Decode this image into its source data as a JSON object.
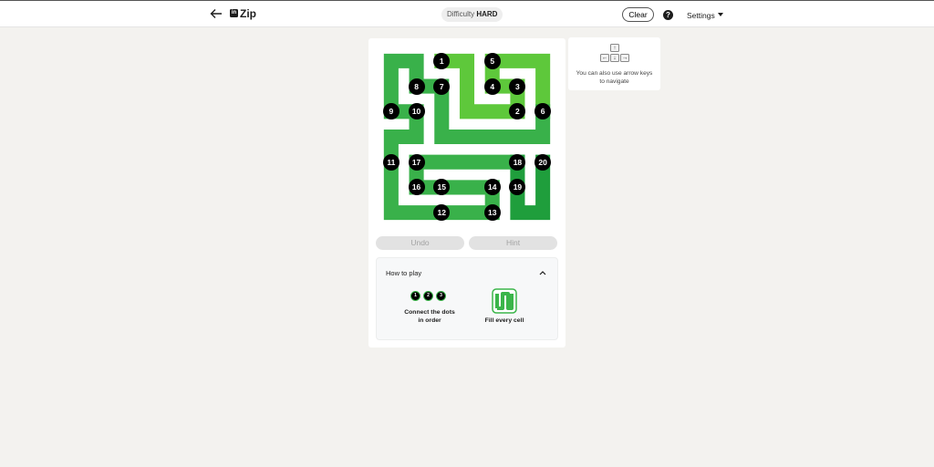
{
  "header": {
    "app_title": "Zip",
    "logo_text": "in",
    "difficulty_label": "Difficulty",
    "difficulty_value": "HARD",
    "clear_label": "Clear",
    "help_label": "?",
    "settings_label": "Settings",
    "icons": {
      "back": "arrow-left-icon",
      "help": "question-circle-icon",
      "settings": "caret-down-icon"
    }
  },
  "game": {
    "grid_size": 7,
    "colors": {
      "path_light": "#5ec83b",
      "path_mid": "#39b14a",
      "path_dark": "#1f9e3c",
      "dot": "#000000",
      "empty": "#ffffff"
    },
    "dots": [
      {
        "n": "1",
        "row": 0,
        "col": 2
      },
      {
        "n": "2",
        "row": 2,
        "col": 5
      },
      {
        "n": "3",
        "row": 1,
        "col": 5
      },
      {
        "n": "4",
        "row": 1,
        "col": 4
      },
      {
        "n": "5",
        "row": 0,
        "col": 4
      },
      {
        "n": "6",
        "row": 2,
        "col": 6
      },
      {
        "n": "7",
        "row": 1,
        "col": 2
      },
      {
        "n": "8",
        "row": 1,
        "col": 1
      },
      {
        "n": "9",
        "row": 2,
        "col": 0
      },
      {
        "n": "10",
        "row": 2,
        "col": 1
      },
      {
        "n": "11",
        "row": 4,
        "col": 0
      },
      {
        "n": "12",
        "row": 6,
        "col": 2
      },
      {
        "n": "13",
        "row": 6,
        "col": 4
      },
      {
        "n": "14",
        "row": 5,
        "col": 4
      },
      {
        "n": "15",
        "row": 5,
        "col": 2
      },
      {
        "n": "16",
        "row": 5,
        "col": 1
      },
      {
        "n": "17",
        "row": 4,
        "col": 1
      },
      {
        "n": "18",
        "row": 4,
        "col": 5
      },
      {
        "n": "19",
        "row": 5,
        "col": 5
      },
      {
        "n": "20",
        "row": 4,
        "col": 6
      }
    ],
    "segments": [
      {
        "shade": "light",
        "cells": [
          [
            0,
            2
          ],
          [
            0,
            3
          ],
          [
            1,
            3
          ],
          [
            2,
            3
          ],
          [
            2,
            4
          ],
          [
            2,
            5
          ],
          [
            1,
            5
          ],
          [
            1,
            4
          ],
          [
            0,
            4
          ],
          [
            0,
            5
          ],
          [
            0,
            6
          ],
          [
            1,
            6
          ],
          [
            2,
            6
          ]
        ]
      },
      {
        "shade": "mid",
        "cells": [
          [
            2,
            6
          ],
          [
            3,
            6
          ],
          [
            3,
            5
          ],
          [
            3,
            4
          ],
          [
            3,
            3
          ],
          [
            3,
            2
          ],
          [
            2,
            2
          ],
          [
            1,
            2
          ],
          [
            1,
            1
          ],
          [
            0,
            1
          ],
          [
            0,
            0
          ],
          [
            1,
            0
          ],
          [
            2,
            0
          ],
          [
            2,
            1
          ],
          [
            3,
            1
          ],
          [
            3,
            0
          ],
          [
            4,
            0
          ],
          [
            5,
            0
          ],
          [
            6,
            0
          ],
          [
            6,
            1
          ],
          [
            6,
            2
          ],
          [
            6,
            3
          ],
          [
            6,
            4
          ],
          [
            5,
            4
          ],
          [
            5,
            3
          ],
          [
            5,
            2
          ],
          [
            5,
            1
          ],
          [
            4,
            1
          ],
          [
            4,
            2
          ],
          [
            4,
            3
          ],
          [
            4,
            4
          ],
          [
            4,
            5
          ]
        ]
      },
      {
        "shade": "dark",
        "cells": [
          [
            4,
            5
          ],
          [
            5,
            5
          ],
          [
            6,
            5
          ],
          [
            6,
            6
          ],
          [
            5,
            6
          ],
          [
            4,
            6
          ]
        ]
      }
    ],
    "undo_label": "Undo",
    "hint_label": "Hint"
  },
  "how_to_play": {
    "title": "How to play",
    "mini_dots": [
      "1",
      "2",
      "3"
    ],
    "connect_caption": "Connect the dots in order",
    "fill_caption": "Fill every cell",
    "icons": {
      "collapse": "chevron-up-icon",
      "fill": "fill-grid-icon"
    }
  },
  "tip": {
    "keys": {
      "up": "↑",
      "left": "←",
      "down": "↓",
      "right": "→"
    },
    "text": "You can also use arrow keys to navigate"
  }
}
